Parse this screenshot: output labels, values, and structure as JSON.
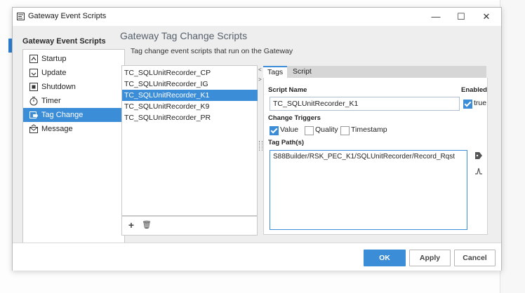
{
  "window": {
    "title": "Gateway Event Scripts",
    "minimize": "—",
    "maximize": "☐",
    "close": "✕"
  },
  "nav": {
    "title": "Gateway Event Scripts",
    "items": [
      {
        "label": "Startup",
        "icon": "startup-icon"
      },
      {
        "label": "Update",
        "icon": "update-icon"
      },
      {
        "label": "Shutdown",
        "icon": "shutdown-icon"
      },
      {
        "label": "Timer",
        "icon": "timer-icon"
      },
      {
        "label": "Tag Change",
        "icon": "tag-change-icon",
        "selected": true
      },
      {
        "label": "Message",
        "icon": "message-icon"
      }
    ]
  },
  "header": {
    "title": "Gateway Tag Change Scripts",
    "subtitle": "Tag change event scripts that run on the Gateway"
  },
  "scripts": {
    "items": [
      "TC_SQLUnitRecorder_CP",
      "TC_SQLUnitRecorder_IG",
      "TC_SQLUnitRecorder_K1",
      "TC_SQLUnitRecorder_K9",
      "TC_SQLUnitRecorder_PR"
    ],
    "selected_index": 2,
    "add": "+",
    "delete": "🗑"
  },
  "editor": {
    "tabs": [
      "Tags",
      "Script"
    ],
    "script_name_label": "Script Name",
    "script_name_value": "TC_SQLUnitRecorder_K1",
    "enabled_label": "Enabled",
    "enabled_text": "true",
    "enabled": true,
    "change_triggers_label": "Change Triggers",
    "triggers": [
      {
        "label": "Value",
        "checked": true
      },
      {
        "label": "Quality",
        "checked": false
      },
      {
        "label": "Timestamp",
        "checked": false
      }
    ],
    "tag_paths_label": "Tag Path(s)",
    "tag_paths_value": "S88Builder/RSK_PEC_K1/SQLUnitRecorder/Record_Rqst"
  },
  "footer": {
    "ok": "OK",
    "apply": "Apply",
    "cancel": "Cancel"
  },
  "colors": {
    "accent": "#3c8dd8"
  }
}
